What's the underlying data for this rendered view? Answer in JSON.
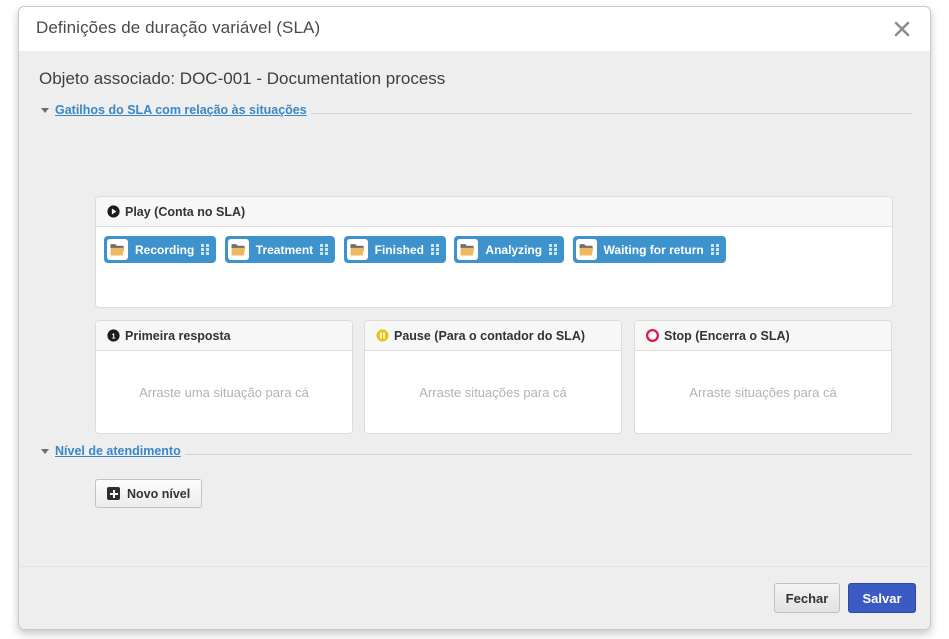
{
  "dialog": {
    "title": "Definições de duração variável (SLA)",
    "close_icon": "close-icon",
    "associated_object": "Objeto associado: DOC-001 - Documentation process"
  },
  "colors": {
    "chip_blue": "#3f93cd",
    "link_blue": "#3a87c8",
    "save_blue": "#3c5ac4",
    "stop_red": "#d81b4a",
    "pause_yellow": "#e8c51c",
    "body_bg": "#eeeeee",
    "panel_bg": "#ffffff"
  },
  "sections": [
    {
      "id": "triggers",
      "label": "Gatilhos do SLA com relação às situações",
      "caret_icon": "caret-down-icon"
    },
    {
      "id": "service-level",
      "label": "Nível de atendimento",
      "caret_icon": "caret-down-icon"
    }
  ],
  "play_panel": {
    "title": "Play (Conta no SLA)",
    "icon": "play-circle-icon",
    "chips": [
      {
        "label": "Recording",
        "icon": "folder-icon",
        "grip": "drag-grip-icon"
      },
      {
        "label": "Treatment",
        "icon": "folder-icon",
        "grip": "drag-grip-icon"
      },
      {
        "label": "Finished",
        "icon": "folder-icon",
        "grip": "drag-grip-icon"
      },
      {
        "label": "Analyzing",
        "icon": "folder-icon",
        "grip": "drag-grip-icon"
      },
      {
        "label": "Waiting for return",
        "icon": "folder-icon",
        "grip": "drag-grip-icon"
      }
    ]
  },
  "drop_panels": [
    {
      "id": "first-response",
      "title": "Primeira resposta",
      "icon": "number-one-circle-icon",
      "placeholder": "Arraste uma situação para cá"
    },
    {
      "id": "pause",
      "title": "Pause (Para o contador do SLA)",
      "icon": "pause-circle-icon",
      "placeholder": "Arraste situações para cá"
    },
    {
      "id": "stop",
      "title": "Stop (Encerra o SLA)",
      "icon": "stop-circle-icon",
      "placeholder": "Arraste situações para cá"
    }
  ],
  "new_level_button": {
    "label": "Novo nível",
    "icon": "plus-square-icon"
  },
  "footer": {
    "close_label": "Fechar",
    "save_label": "Salvar"
  }
}
